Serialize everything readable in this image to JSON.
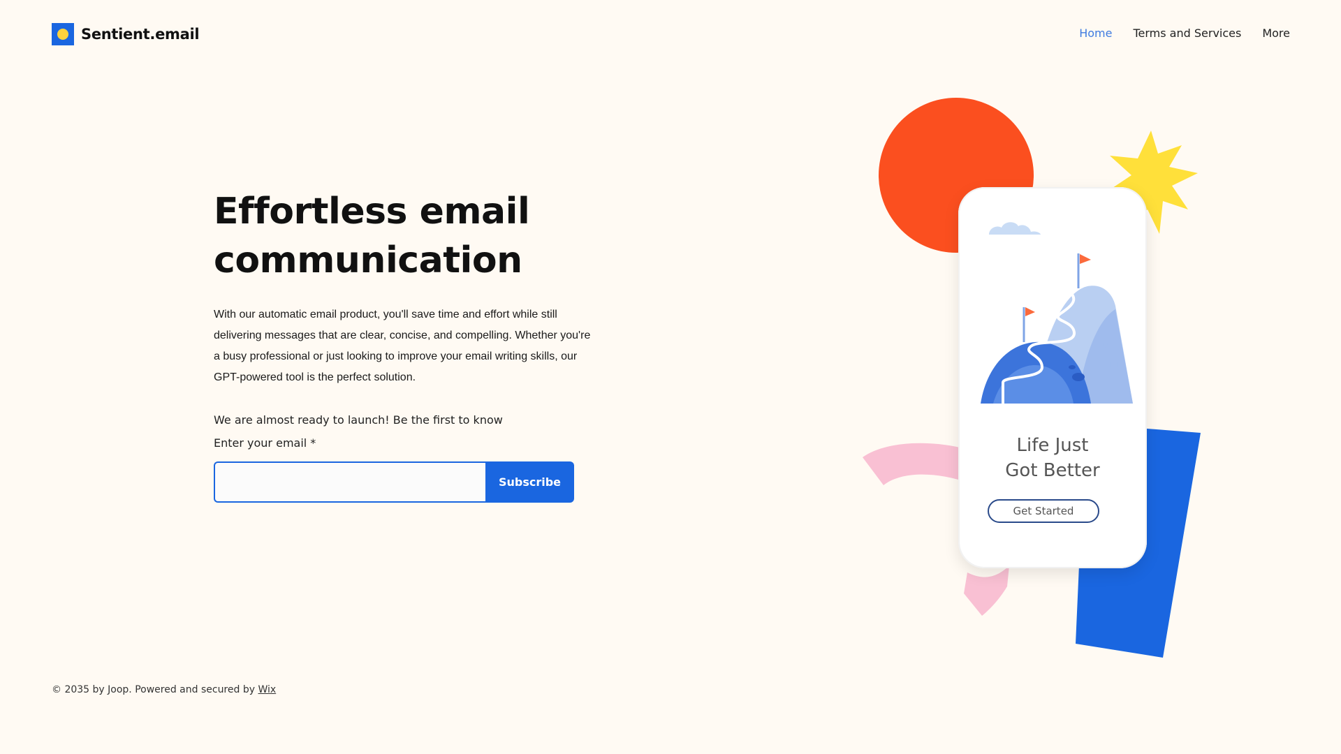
{
  "header": {
    "brand": "Sentient.email",
    "nav": [
      {
        "label": "Home",
        "active": true
      },
      {
        "label": "Terms and Services",
        "active": false
      },
      {
        "label": "More",
        "active": false
      }
    ]
  },
  "hero": {
    "title_line1": "Effortless email",
    "title_line2": "communication",
    "description": "With our automatic email product, you'll save time and effort while still delivering messages that are clear, concise, and compelling. Whether you're a busy professional or just looking to improve your email writing skills, our GPT-powered tool is the perfect solution.",
    "launch_text": "We are almost ready to launch! Be the first to know",
    "email_label": "Enter your email *",
    "email_value": "",
    "email_placeholder": "",
    "subscribe_label": "Subscribe"
  },
  "illustration": {
    "phone_heading_line1": "Life Just",
    "phone_heading_line2": "Got Better",
    "phone_button_label": "Get Started"
  },
  "footer": {
    "text": "© 2035 by Joop. Powered and secured by",
    "link_label": "Wix"
  },
  "colors": {
    "background": "#fffaf3",
    "accent_blue": "#1a66e0",
    "nav_active": "#3f7be0",
    "orange_circle": "#fb4f1f",
    "yellow_star": "#ffe03a",
    "pink_arc": "#f9c0d3"
  }
}
